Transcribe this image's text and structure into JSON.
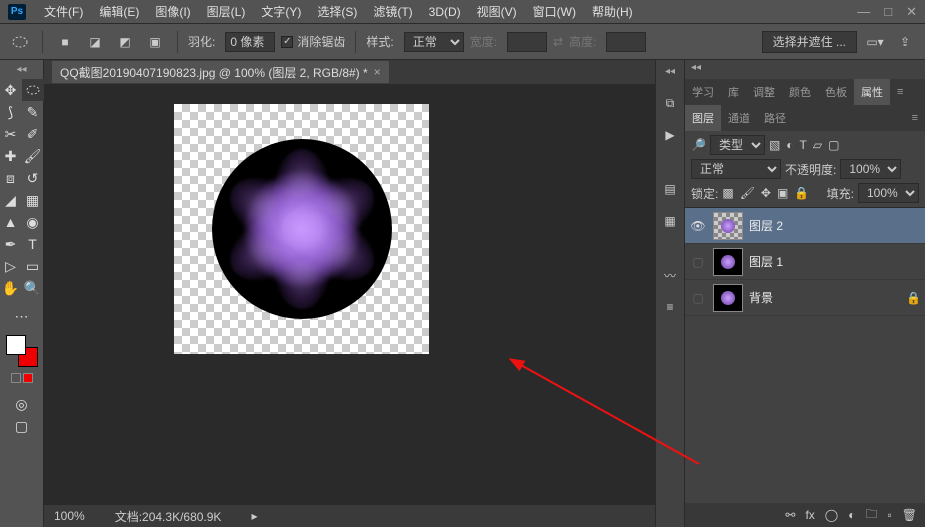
{
  "menu": {
    "items": [
      "文件(F)",
      "编辑(E)",
      "图像(I)",
      "图层(L)",
      "文字(Y)",
      "选择(S)",
      "滤镜(T)",
      "3D(D)",
      "视图(V)",
      "窗口(W)",
      "帮助(H)"
    ]
  },
  "options": {
    "feather_label": "羽化:",
    "feather_value": "0 像素",
    "antialias": "消除锯齿",
    "style_label": "样式:",
    "style_value": "正常",
    "width_label": "宽度:",
    "height_label": "高度:",
    "select_mask": "选择并遮住 ..."
  },
  "document": {
    "tab_title": "QQ截图20190407190823.jpg @ 100% (图层 2, RGB/8#) *",
    "zoom": "100%",
    "doc_info": "文档:204.3K/680.9K"
  },
  "panels_top": {
    "tabs": [
      "学习",
      "库",
      "调整",
      "颜色",
      "色板",
      "属性"
    ],
    "active": 5
  },
  "panels_mid": {
    "tabs": [
      "图层",
      "通道",
      "路径"
    ],
    "active": 0
  },
  "layers": {
    "filter_label": "类型",
    "blend_mode": "正常",
    "opacity_label": "不透明度:",
    "opacity_value": "100%",
    "lock_label": "锁定:",
    "fill_label": "填充:",
    "fill_value": "100%",
    "items": [
      {
        "name": "图层 2",
        "visible": true,
        "active": true,
        "locked": false,
        "checker": true
      },
      {
        "name": "图层 1",
        "visible": false,
        "active": false,
        "locked": false,
        "checker": false
      },
      {
        "name": "背景",
        "visible": false,
        "active": false,
        "locked": true,
        "checker": false
      }
    ]
  }
}
